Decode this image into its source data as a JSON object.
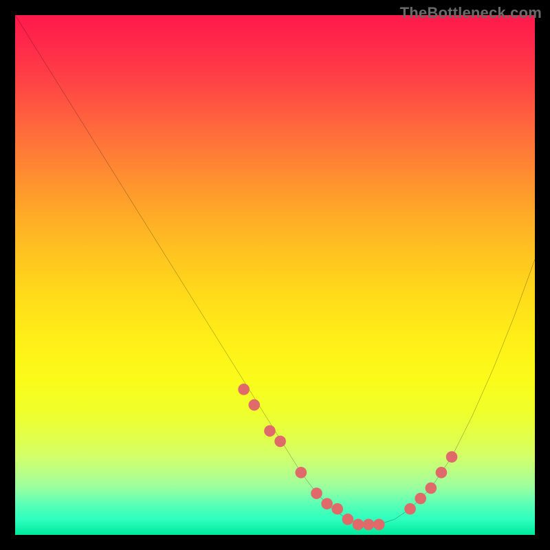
{
  "watermark": {
    "text": "TheBottleneck.com"
  },
  "chart_data": {
    "type": "line",
    "title": "",
    "xlabel": "",
    "ylabel": "",
    "xlim": [
      0,
      100
    ],
    "ylim": [
      0,
      100
    ],
    "grid": false,
    "legend": false,
    "annotations": [],
    "series": [
      {
        "name": "bottleneck-curve",
        "color": "#000000",
        "x": [
          0,
          5,
          10,
          15,
          20,
          25,
          30,
          35,
          40,
          45,
          50,
          55,
          58,
          61,
          64,
          67,
          70,
          73,
          76,
          80,
          84,
          88,
          92,
          96,
          100
        ],
        "values": [
          100,
          92,
          84,
          76,
          68,
          60,
          52,
          44,
          36,
          28,
          20,
          12,
          8,
          5,
          3,
          2,
          2,
          3,
          5,
          9,
          15,
          23,
          32,
          42,
          53
        ]
      }
    ],
    "markers": {
      "name": "highlight-dots",
      "color": "#e06a6a",
      "radius_pct": 1.1,
      "x": [
        44,
        46,
        49,
        51,
        55,
        58,
        60,
        62,
        64,
        66,
        68,
        70,
        76,
        78,
        80,
        82,
        84
      ],
      "values": [
        28,
        25,
        20,
        18,
        12,
        8,
        6,
        5,
        3,
        2,
        2,
        2,
        5,
        7,
        9,
        12,
        15
      ]
    },
    "background_gradient": {
      "stops": [
        {
          "pct": 0,
          "color": "#ff1a4b"
        },
        {
          "pct": 14,
          "color": "#ff4844"
        },
        {
          "pct": 30,
          "color": "#ff8a32"
        },
        {
          "pct": 46,
          "color": "#ffc420"
        },
        {
          "pct": 62,
          "color": "#ffee18"
        },
        {
          "pct": 76,
          "color": "#f0ff2a"
        },
        {
          "pct": 88,
          "color": "#b8ff87"
        },
        {
          "pct": 95,
          "color": "#4affb8"
        },
        {
          "pct": 100,
          "color": "#00e99a"
        }
      ]
    }
  }
}
